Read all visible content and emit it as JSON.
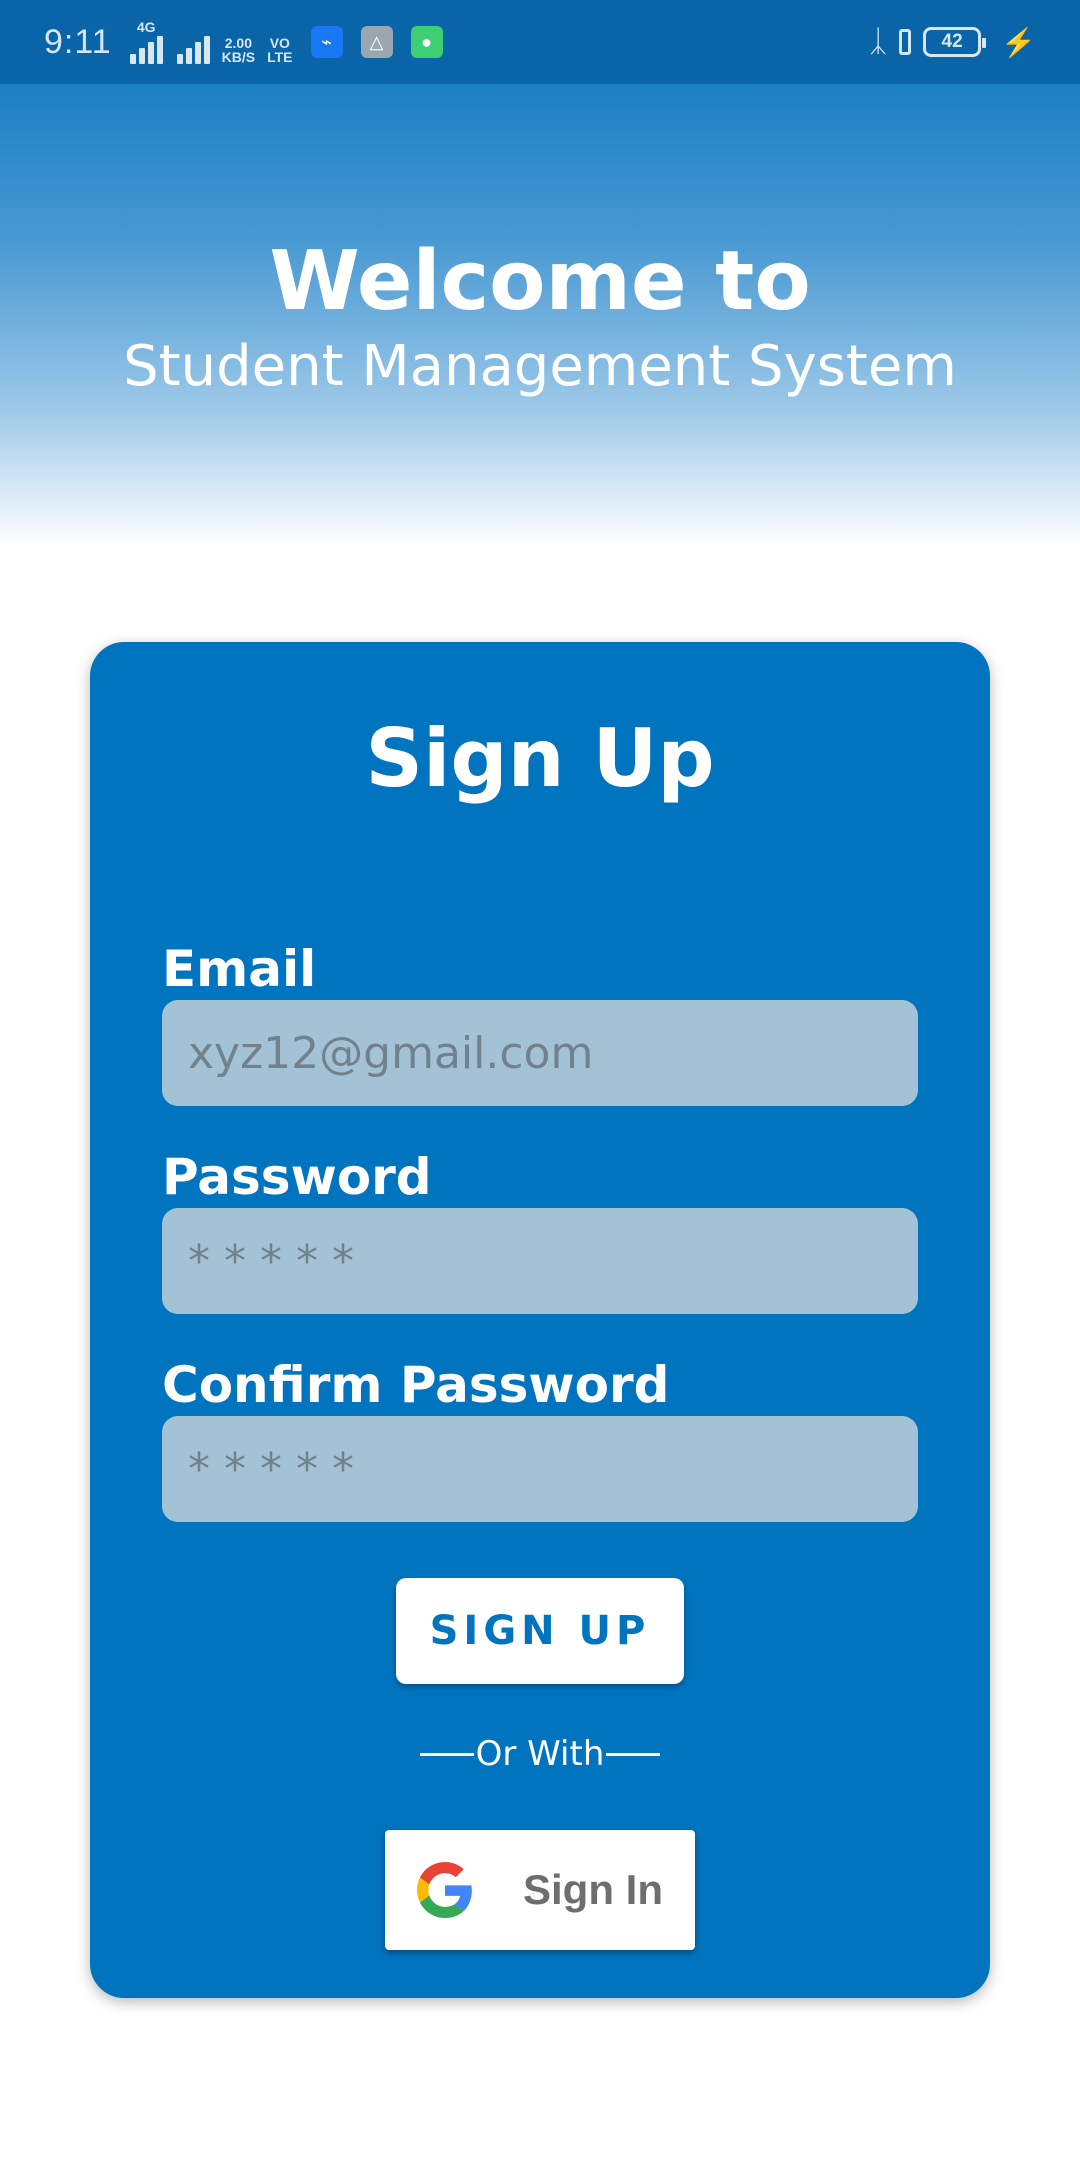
{
  "status_bar": {
    "time": "9:11",
    "network_type": "4G",
    "speed_value": "2.00",
    "speed_unit": "KB/S",
    "volte_top": "VO",
    "volte_bottom": "LTE",
    "battery_level": "42",
    "icons": [
      "usb-icon",
      "app-icon",
      "chat-app-icon",
      "bluetooth-icon",
      "vibrate-icon",
      "charging-icon"
    ]
  },
  "header": {
    "title": "Welcome to",
    "subtitle": "Student Management System"
  },
  "form": {
    "title": "Sign Up",
    "email_label": "Email",
    "email_placeholder": "xyz12@gmail.com",
    "password_label": "Password",
    "password_placeholder": "* * * * *",
    "confirm_label": "Confirm Password",
    "confirm_placeholder": "* * * * *",
    "submit_label": "SIGN UP",
    "divider_text": "Or With",
    "google_label": "Sign In"
  },
  "colors": {
    "primary": "#0174c0",
    "input_bg": "#a3c2d6",
    "status_bar": "#0a64a8"
  }
}
